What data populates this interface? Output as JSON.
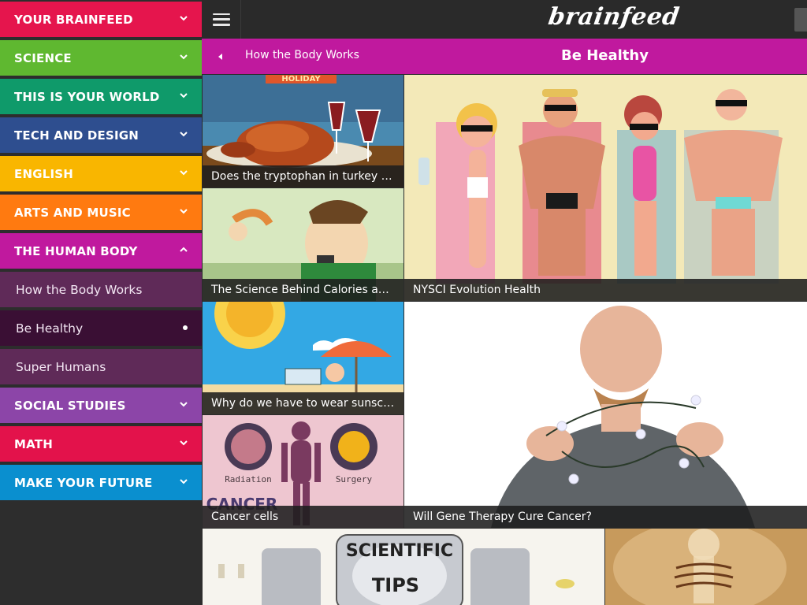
{
  "sidebar": {
    "categories": [
      {
        "label": "YOUR BRAINFEED",
        "color": "#e5154d"
      },
      {
        "label": "SCIENCE",
        "color": "#5fb830"
      },
      {
        "label": "THIS IS YOUR WORLD",
        "color": "#0f9a6a"
      },
      {
        "label": "TECH AND DESIGN",
        "color": "#2e4e8f"
      },
      {
        "label": "ENGLISH",
        "color": "#f9b600"
      },
      {
        "label": "ARTS AND MUSIC",
        "color": "#ff7a10"
      },
      {
        "label": "THE HUMAN BODY",
        "color": "#c0199e"
      },
      {
        "label": "SOCIAL STUDIES",
        "color": "#8c45a8"
      },
      {
        "label": "MATH",
        "color": "#e3124b"
      },
      {
        "label": "MAKE YOUR FUTURE",
        "color": "#0a8fcf"
      }
    ],
    "subitems": [
      {
        "label": "How the Body Works",
        "color": "#5f2a58"
      },
      {
        "label": "Be Healthy",
        "color": "#3a0f34",
        "selected": true
      },
      {
        "label": "Super Humans",
        "color": "#5f2a58"
      }
    ]
  },
  "topbar": {
    "menu_icon": "hamburger-icon",
    "logo": "brainfeed"
  },
  "breadcrumb": {
    "parent": "How the Body Works",
    "title": "Be Healthy",
    "back_icon": "chevron-left-icon",
    "color": "#c0199e"
  },
  "tiles": [
    {
      "caption": "Does the tryptophan in turkey make you sleepy?"
    },
    {
      "caption": "NYSCI Evolution Health"
    },
    {
      "caption": "The Science Behind Calories and Weight"
    },
    {
      "caption": "Why do we have to wear sunscreen?"
    },
    {
      "caption": "Will Gene Therapy Cure Cancer?"
    },
    {
      "caption": "Cancer cells"
    },
    {
      "caption": ""
    },
    {
      "caption": ""
    }
  ],
  "art_text": {
    "holiday": "HOLIDAY",
    "radiation": "Radiation",
    "surgery": "Surgery",
    "cancer": "CANCER",
    "scientific": "SCIENTIFIC",
    "tips": "TIPS"
  }
}
